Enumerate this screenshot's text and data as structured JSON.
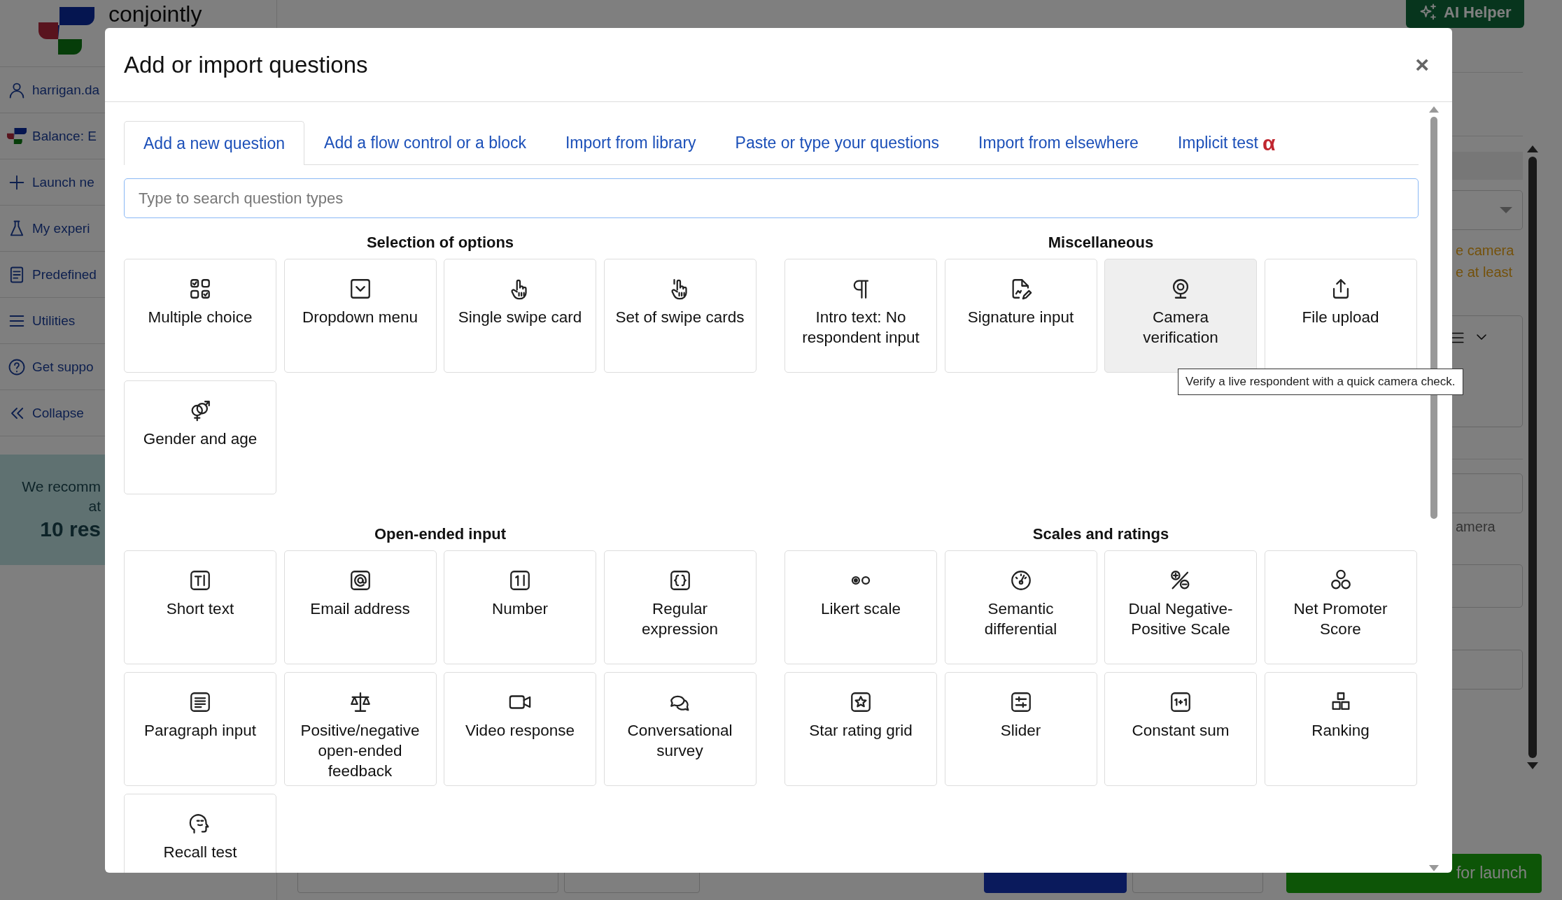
{
  "background": {
    "logo": "conjointly",
    "ai_helper": "AI Helper",
    "sidebar": [
      {
        "label": "harrigan.da"
      },
      {
        "label": "Balance: E"
      },
      {
        "label": "Launch ne"
      },
      {
        "label": "My experi"
      },
      {
        "label": "Predefined"
      },
      {
        "label": "Utilities"
      },
      {
        "label": "Get suppo"
      },
      {
        "label": "Collapse"
      }
    ],
    "recommendation": {
      "line_1": "We recomm",
      "line_2": "at",
      "line_3": "10 res"
    },
    "side_panel": {
      "notice": [
        "e camera",
        "e at least"
      ],
      "hint": "amera"
    },
    "footer_buttons": [
      {
        "kind": "outline"
      },
      {
        "kind": "outline"
      },
      {
        "kind": "primary"
      },
      {
        "kind": "outline"
      },
      {
        "kind": "success",
        "label": "for launch"
      }
    ]
  },
  "dialog": {
    "title": "Add or import questions",
    "close": "×",
    "tabs": [
      {
        "label": "Add a new question",
        "selected": true
      },
      {
        "label": "Add a flow control or a block",
        "selected": false
      },
      {
        "label": "Import from library",
        "selected": false
      },
      {
        "label": "Paste or type your questions",
        "selected": false
      },
      {
        "label": "Import from elsewhere",
        "selected": false
      },
      {
        "label": "Implicit test",
        "selected": false,
        "badge": "α"
      }
    ],
    "search": {
      "placeholder": "Type to search question types"
    },
    "sections": [
      {
        "title": "Selection of options",
        "cards": [
          {
            "label": "Multiple choice",
            "hovered": false
          },
          {
            "label": "Dropdown menu",
            "hovered": false
          },
          {
            "label": "Single swipe card",
            "hovered": false
          },
          {
            "label": "Set of swipe cards",
            "hovered": false
          },
          {
            "label": "Gender and age",
            "hovered": false
          }
        ]
      },
      {
        "title": "Miscellaneous",
        "cards": [
          {
            "label": "Intro text: No respondent input",
            "hovered": false
          },
          {
            "label": "Signature input",
            "hovered": false
          },
          {
            "label": "Camera verification",
            "hovered": true
          },
          {
            "label": "File upload",
            "hovered": false
          }
        ]
      },
      {
        "title": "Open-ended input",
        "cards": [
          {
            "label": "Short text",
            "hovered": false
          },
          {
            "label": "Email address",
            "hovered": false
          },
          {
            "label": "Number",
            "hovered": false
          },
          {
            "label": "Regular expression",
            "hovered": false
          },
          {
            "label": "Paragraph input",
            "hovered": false
          },
          {
            "label": "Positive/negative open-ended feedback",
            "hovered": false
          },
          {
            "label": "Video response",
            "hovered": false
          },
          {
            "label": "Conversational survey",
            "hovered": false
          },
          {
            "label": "Recall test",
            "hovered": false
          }
        ]
      },
      {
        "title": "Scales and ratings",
        "cards": [
          {
            "label": "Likert scale",
            "hovered": false
          },
          {
            "label": "Semantic differential",
            "hovered": false
          },
          {
            "label": "Dual Negative-Positive Scale",
            "hovered": false
          },
          {
            "label": "Net Promoter Score",
            "hovered": false
          },
          {
            "label": "Star rating grid",
            "hovered": false
          },
          {
            "label": "Slider",
            "hovered": false
          },
          {
            "label": "Constant sum",
            "hovered": false
          },
          {
            "label": "Ranking",
            "hovered": false
          }
        ]
      }
    ],
    "tooltip": "Verify a live respondent with a quick camera check."
  }
}
